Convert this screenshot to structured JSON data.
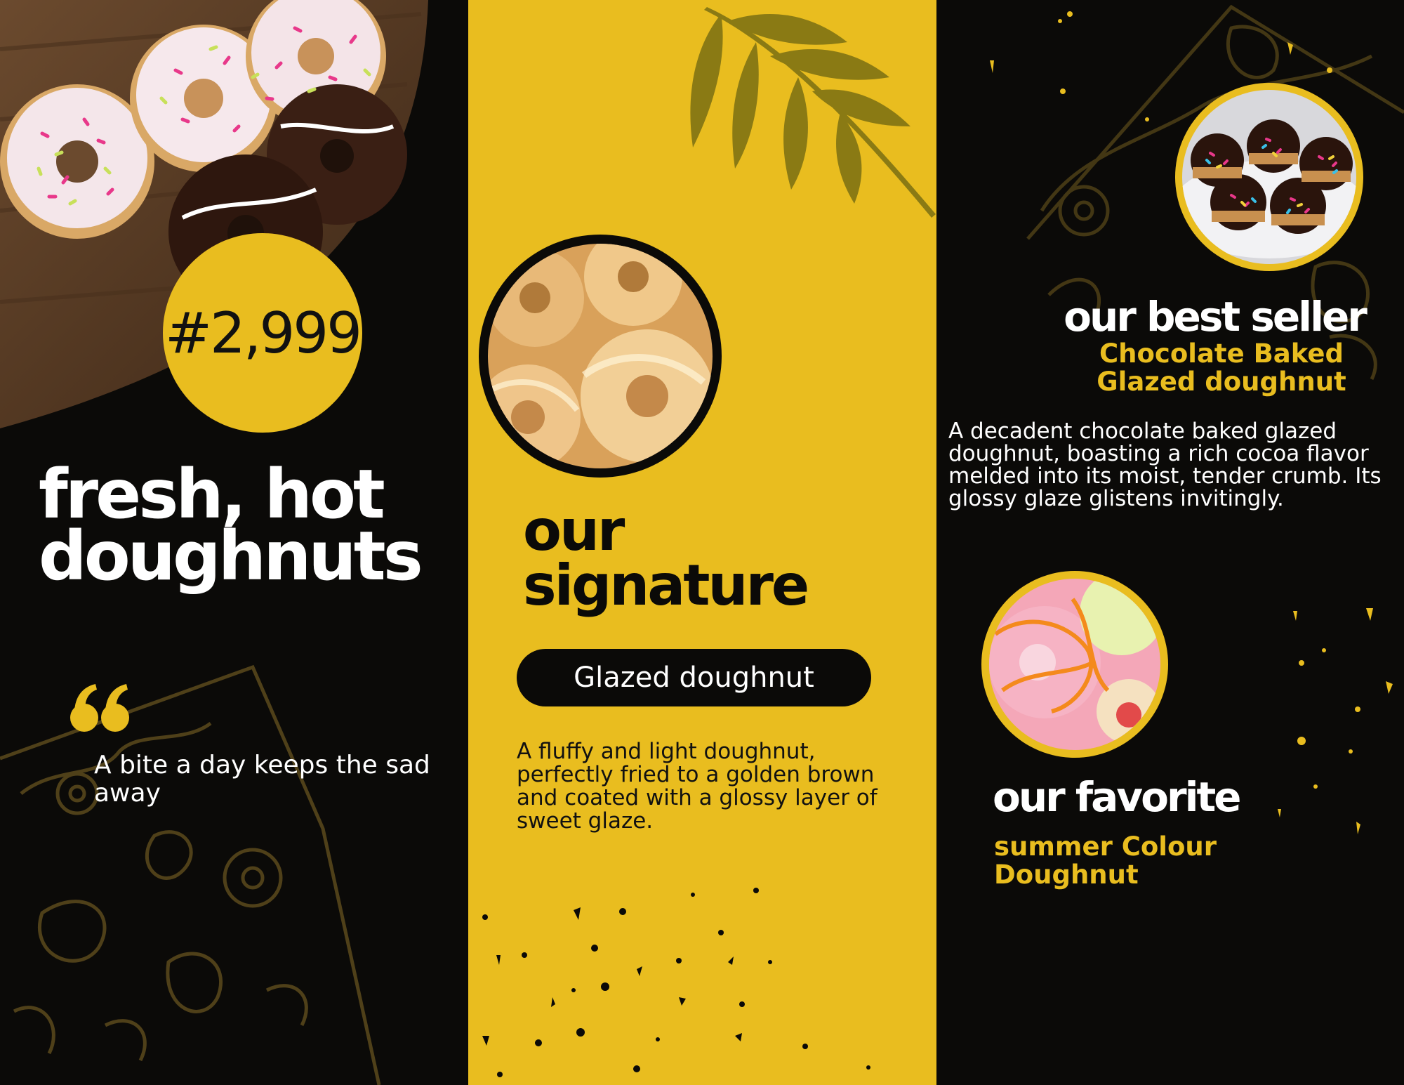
{
  "left": {
    "price": "#2,999",
    "headline_line1": "fresh, hot",
    "headline_line2": "doughnuts",
    "quote": "A bite a day keeps the sad away"
  },
  "middle": {
    "title_line1": "our",
    "title_line2": "signature",
    "pill_label": "Glazed doughnut",
    "description": "A fluffy and light doughnut, perfectly fried to a golden brown and coated with a glossy layer of sweet glaze."
  },
  "right": {
    "best_title": "our best seller",
    "best_subtitle_line1": "Chocolate Baked",
    "best_subtitle_line2": "Glazed doughnut",
    "best_description": "A decadent chocolate baked glazed doughnut, boasting a rich cocoa flavor melded into its moist, tender crumb. Its glossy glaze glistens invitingly.",
    "favorite_title": "our favorite",
    "favorite_subtitle_line1": "summer Colour",
    "favorite_subtitle_line2": "Doughnut"
  },
  "colors": {
    "yellow": "#e9bd1f",
    "black": "#0b0a08",
    "olive_leaf": "#8a7a14",
    "white": "#ffffff"
  },
  "icons": [
    "quote-icon",
    "leaf-icon",
    "speckle-decoration",
    "doodle-decoration"
  ]
}
